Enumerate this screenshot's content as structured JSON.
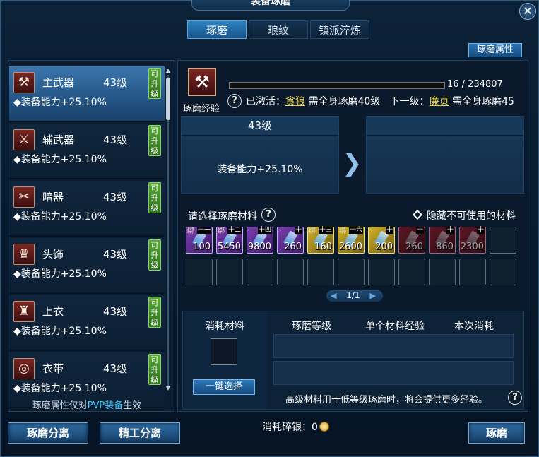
{
  "window": {
    "title": "装备琢磨",
    "close_label": "✕"
  },
  "tabs": [
    {
      "label": "琢磨",
      "active": true
    },
    {
      "label": "琅纹",
      "active": false
    },
    {
      "label": "镇派淬炼",
      "active": false
    }
  ],
  "attr_button": "琢磨属性",
  "equipment": [
    {
      "name": "主武器",
      "level": "43级",
      "attr": "◆装备能力+25.10%",
      "upgrade": "可升级",
      "icon": "weapon-icon",
      "glyph": "⚒"
    },
    {
      "name": "辅武器",
      "level": "43级",
      "attr": "◆装备能力+25.10%",
      "upgrade": "可升级",
      "icon": "crossed-swords-icon",
      "glyph": "⚔"
    },
    {
      "name": "暗器",
      "level": "43级",
      "attr": "◆装备能力+25.10%",
      "upgrade": "可升级",
      "icon": "dart-icon",
      "glyph": "✂"
    },
    {
      "name": "头饰",
      "level": "43级",
      "attr": "◆装备能力+25.10%",
      "upgrade": "可升级",
      "icon": "helmet-icon",
      "glyph": "♛"
    },
    {
      "name": "上衣",
      "level": "43级",
      "attr": "◆装备能力+25.10%",
      "upgrade": "可升级",
      "icon": "robe-icon",
      "glyph": "♜"
    },
    {
      "name": "衣带",
      "level": "43级",
      "attr": "◆装备能力+25.10%",
      "upgrade": "可升级",
      "icon": "belt-icon",
      "glyph": "◎"
    }
  ],
  "pvp_note": {
    "prefix": "琢磨属性仅对",
    "highlight": "PVP装备",
    "suffix": "生效"
  },
  "detail": {
    "exp_label": "琢磨经验",
    "exp_current": 16,
    "exp_max": 234807,
    "exp_text": "16 / 234807",
    "activated_prefix": "已激活：",
    "activated_name": "贪狼",
    "activated_req": "需全身琢磨40级",
    "next_prefix": "下一级：",
    "next_name": "廉贞",
    "next_req": "需全身琢磨45",
    "current_level": "43级",
    "current_attr": "装备能力+25.10%",
    "next_level": "",
    "next_attr": ""
  },
  "materials": {
    "title": "请选择琢磨材料",
    "hide_unusable": "隐藏不可使用的材料",
    "items": [
      {
        "color": "purple",
        "bind": "绑",
        "lvl": "十一",
        "count": "100"
      },
      {
        "color": "purple",
        "bind": "绑",
        "lvl": "十二",
        "count": "5450"
      },
      {
        "color": "purple",
        "bind": "",
        "lvl": "十四",
        "count": "9800"
      },
      {
        "color": "purple",
        "bind": "",
        "lvl": "十",
        "count": "260"
      },
      {
        "color": "yellow",
        "bind": "绑",
        "lvl": "十三",
        "count": "160"
      },
      {
        "color": "yellow",
        "bind": "绑",
        "lvl": "十六",
        "count": "2600"
      },
      {
        "color": "yellow",
        "bind": "",
        "lvl": "十",
        "count": "200"
      },
      {
        "color": "red",
        "bind": "",
        "lvl": "十",
        "count": "260"
      },
      {
        "color": "red",
        "bind": "",
        "lvl": "十",
        "count": "860"
      },
      {
        "color": "red",
        "bind": "",
        "lvl": "十",
        "count": "2300"
      }
    ],
    "page": "1/1"
  },
  "consume": {
    "label": "消耗材料",
    "auto_select": "一键选择",
    "columns": [
      "琢磨等级",
      "单个材料经验",
      "本次消耗"
    ],
    "tip": "高级材料用于低等级琢磨时，将会提供更多经验。"
  },
  "footer": {
    "separate": "琢磨分离",
    "fine_separate": "精工分离",
    "silver_label": "消耗碎银：",
    "silver_value": "0",
    "polish": "琢磨"
  }
}
